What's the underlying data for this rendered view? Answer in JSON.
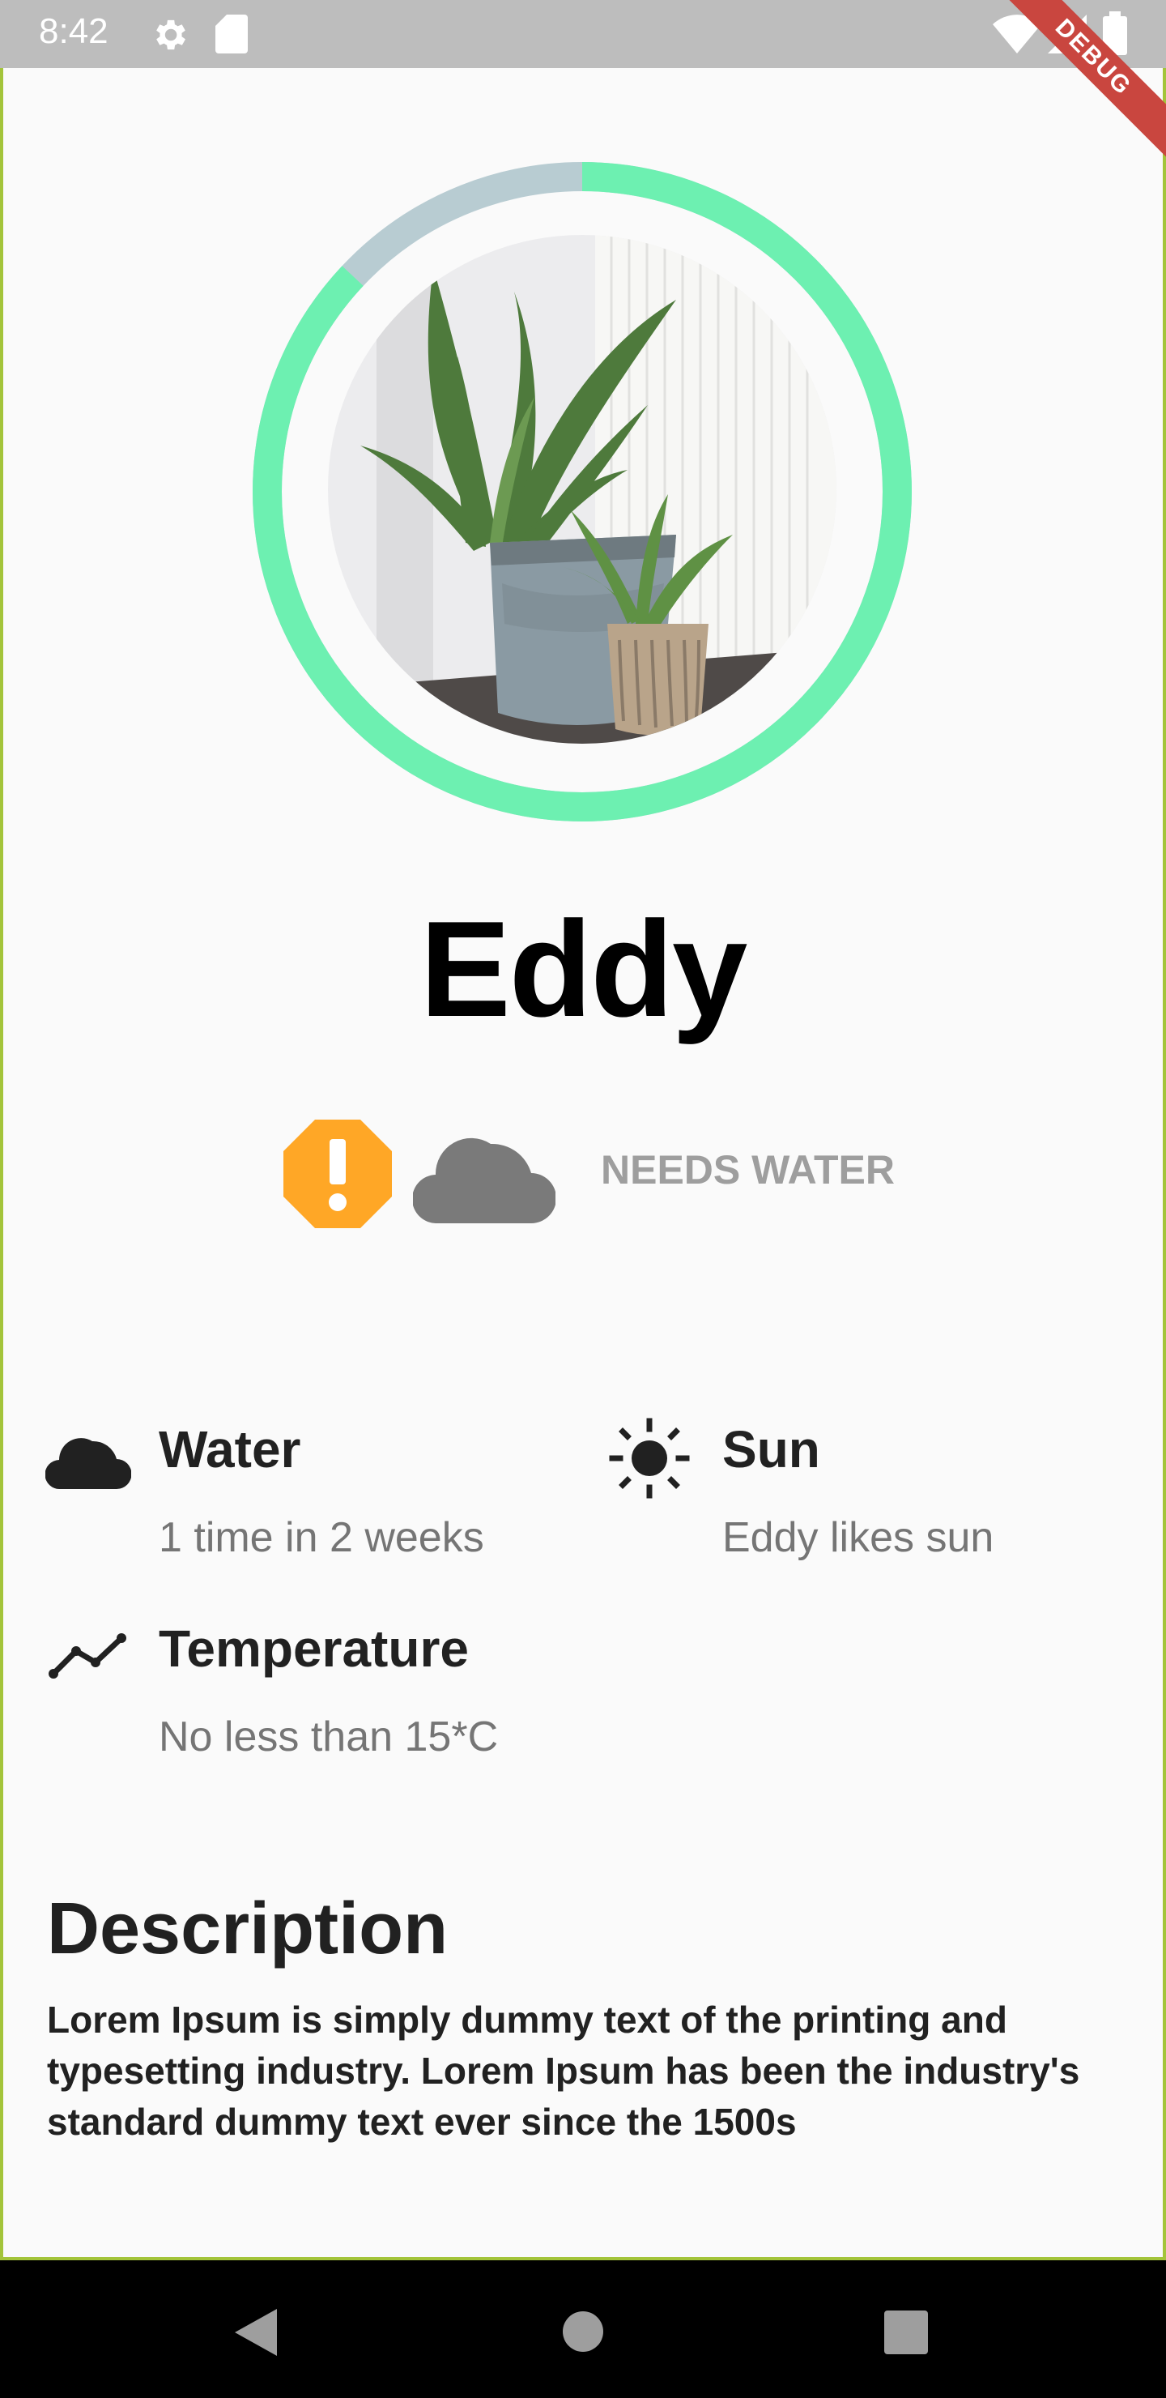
{
  "status_bar": {
    "time": "8:42",
    "debug": "DEBUG"
  },
  "plant": {
    "name": "Eddy",
    "status_label": "NEEDS WATER",
    "ring_progress": 0.87,
    "ring_color": "#6df0b1",
    "ring_track_color": "#b8ccd2",
    "warning_color": "#ffa726"
  },
  "care": {
    "water": {
      "title": "Water",
      "subtitle": "1 time in 2 weeks"
    },
    "sun": {
      "title": "Sun",
      "subtitle": "Eddy likes sun"
    },
    "temperature": {
      "title": "Temperature",
      "subtitle": "No less than 15*C"
    }
  },
  "description": {
    "title": "Description",
    "body": "Lorem Ipsum is simply dummy text of the printing and typesetting industry. Lorem Ipsum has been the industry's standard dummy text ever since the 1500s"
  },
  "icons": {
    "settings": "gear-icon",
    "sd": "sd-card-icon",
    "wifi": "wifi-icon",
    "signal": "signal-icon",
    "battery": "battery-icon",
    "warning": "warning-octagon-icon",
    "cloud": "cloud-icon",
    "sun": "sun-icon",
    "trend": "trend-line-icon",
    "back": "back-icon",
    "home": "home-icon",
    "recents": "recents-icon"
  }
}
